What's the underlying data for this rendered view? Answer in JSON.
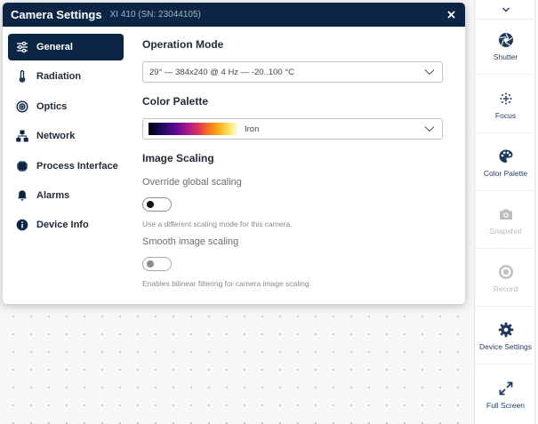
{
  "dialog": {
    "title": "Camera Settings",
    "subtitle": "XI 410 (SN: 23044105)"
  },
  "nav": {
    "items": [
      {
        "label": "General",
        "icon": "sliders-icon",
        "active": true
      },
      {
        "label": "Radiation",
        "icon": "thermometer-icon"
      },
      {
        "label": "Optics",
        "icon": "lens-icon"
      },
      {
        "label": "Network",
        "icon": "network-icon"
      },
      {
        "label": "Process Interface",
        "icon": "chip-icon"
      },
      {
        "label": "Alarms",
        "icon": "bell-icon"
      },
      {
        "label": "Device Info",
        "icon": "info-icon"
      }
    ]
  },
  "general": {
    "operation_mode_title": "Operation Mode",
    "operation_mode_value": "29° — 384x240 @ 4 Hz — -20..100 °C",
    "color_palette_title": "Color Palette",
    "color_palette_value": "Iron",
    "image_scaling_title": "Image Scaling",
    "override_label": "Override global scaling",
    "override_enabled": false,
    "override_hint": "Use a different scaling mode for this camera.",
    "smooth_label": "Smooth image scaling",
    "smooth_enabled": false,
    "smooth_hint": "Enables bilinear filtering for camera image scaling."
  },
  "toolbar": {
    "items": [
      {
        "label": "Shutter",
        "icon": "shutter-icon",
        "enabled": true
      },
      {
        "label": "Focus",
        "icon": "focus-icon",
        "enabled": true
      },
      {
        "label": "Color Palette",
        "icon": "palette-icon",
        "enabled": true
      },
      {
        "label": "Snapshot",
        "icon": "camera-icon",
        "enabled": false
      },
      {
        "label": "Record",
        "icon": "record-icon",
        "enabled": false
      },
      {
        "label": "Device Settings",
        "icon": "gear-icon",
        "enabled": true
      },
      {
        "label": "Full Screen",
        "icon": "expand-icon",
        "enabled": true
      }
    ]
  },
  "colors": {
    "header_bg": "#0d2544",
    "accent": "#1f3a5f",
    "disabled": "#b9b9b9"
  }
}
